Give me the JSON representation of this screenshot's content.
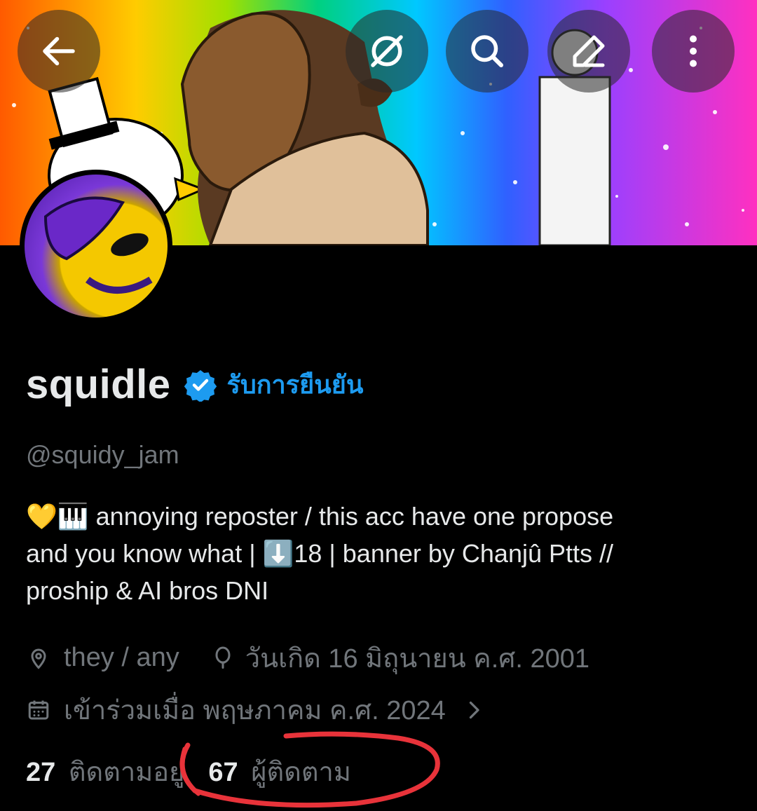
{
  "header": {
    "back_icon": "arrow-left-icon",
    "grok_icon": "grok-icon",
    "search_icon": "search-icon",
    "edit_icon": "edit-icon",
    "more_icon": "more-vertical-icon"
  },
  "profile": {
    "display_name": "squidle",
    "verify_label": "รับการยืนยัน",
    "handle": "@squidy_jam",
    "bio_line1": "💛🎹 annoying reposter / this acc have one propose",
    "bio_line2": "and you know what | ⬇️18 | banner by Chanjû Ptts  //",
    "bio_line3": "proship & AI bros DNI",
    "pronouns": "they / any",
    "birthday": "วันเกิด 16 มิถุนายน ค.ศ. 2001",
    "joined": "เข้าร่วมเมื่อ พฤษภาคม ค.ศ. 2024",
    "following_count": "27",
    "following_label": "ติดตามอยู่",
    "followers_count": "67",
    "followers_label": "ผู้ติดตาม"
  },
  "colors": {
    "accent": "#1d9bf0",
    "annotation": "#e8333a"
  }
}
